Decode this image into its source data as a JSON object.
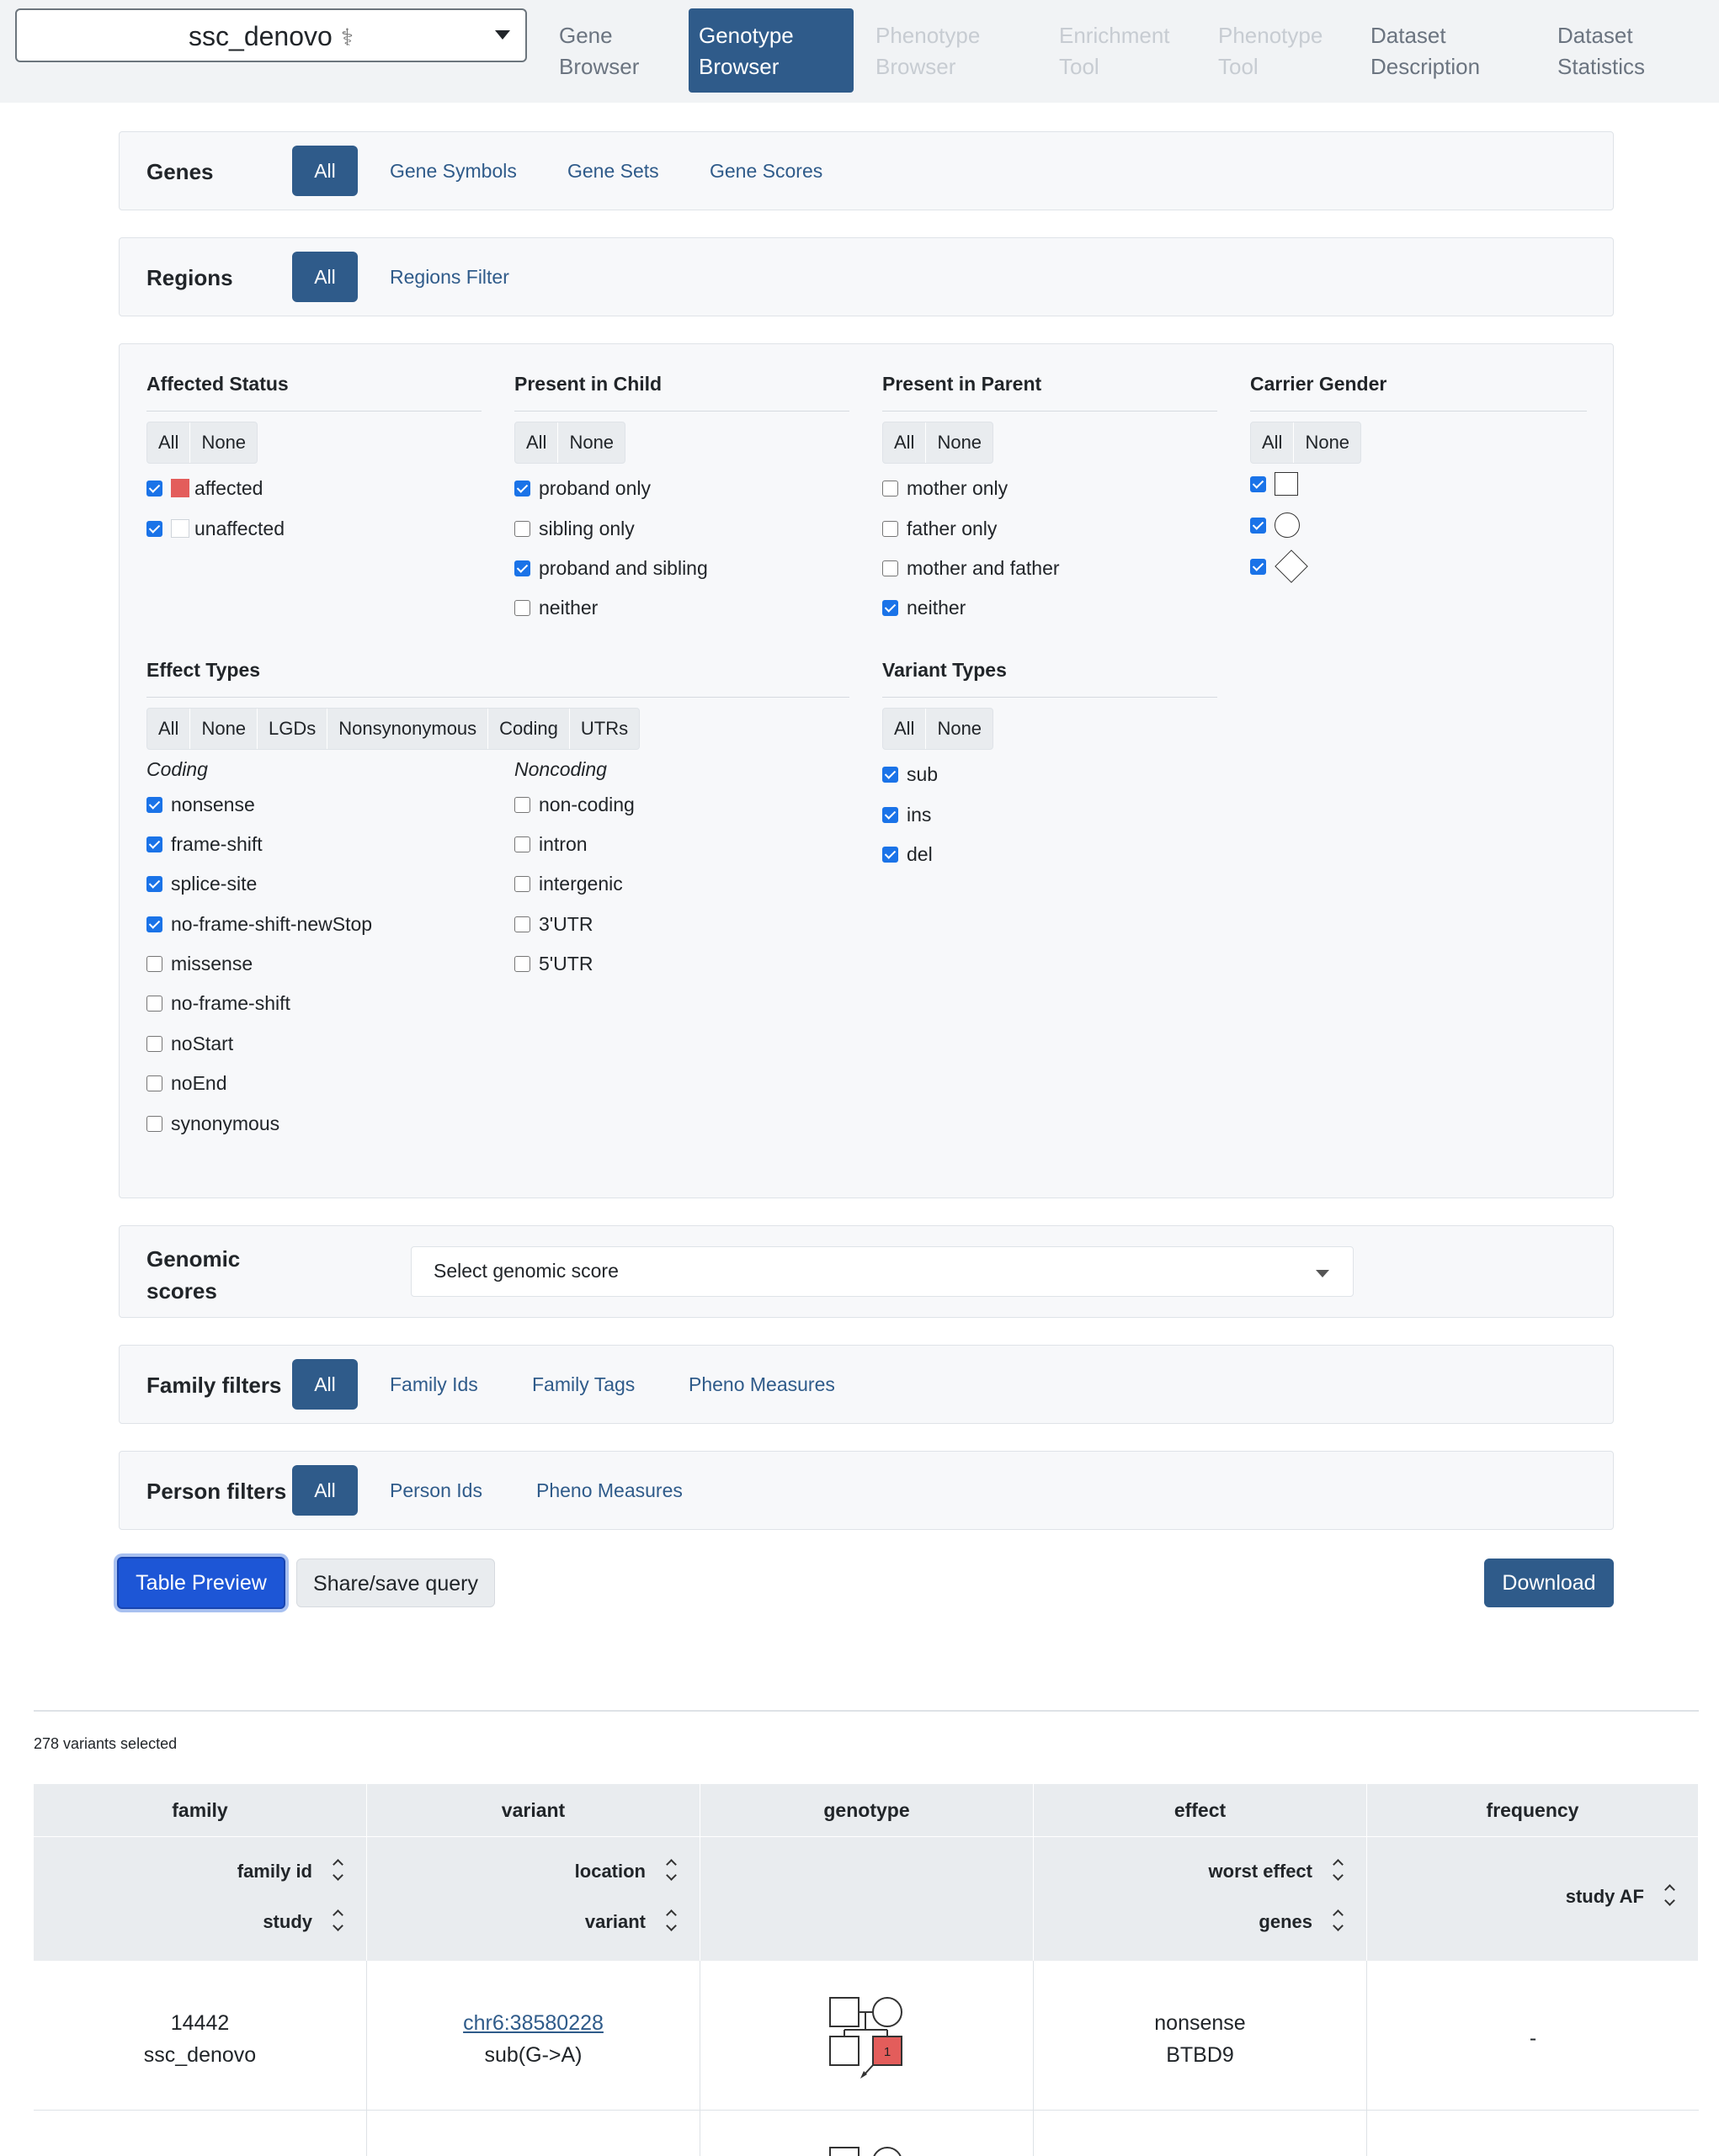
{
  "nav": {
    "dataset": "ssc_denovo",
    "dataset_icon": "dna-icon",
    "tabs": [
      {
        "label": "Gene\nBrowser",
        "state": "normal"
      },
      {
        "label": "Genotype\nBrowser",
        "state": "active"
      },
      {
        "label": "Phenotype\nBrowser",
        "state": "disabled"
      },
      {
        "label": "Enrichment\nTool",
        "state": "disabled"
      },
      {
        "label": "Phenotype\nTool",
        "state": "disabled"
      },
      {
        "label": "Dataset\nDescription",
        "state": "normal"
      },
      {
        "label": "Dataset\nStatistics",
        "state": "normal"
      }
    ]
  },
  "genes": {
    "title": "Genes",
    "tabs": [
      "All",
      "Gene Symbols",
      "Gene Sets",
      "Gene Scores"
    ],
    "active": "All"
  },
  "regions": {
    "title": "Regions",
    "tabs": [
      "All",
      "Regions Filter"
    ],
    "active": "All"
  },
  "filters": {
    "affected_status": {
      "title": "Affected Status",
      "buttons": [
        "All",
        "None"
      ],
      "options": [
        {
          "label": "affected",
          "checked": true,
          "color": "#e35d5b"
        },
        {
          "label": "unaffected",
          "checked": true,
          "color": "#ffffff"
        }
      ]
    },
    "present_in_child": {
      "title": "Present in Child",
      "buttons": [
        "All",
        "None"
      ],
      "options": [
        {
          "label": "proband only",
          "checked": true
        },
        {
          "label": "sibling only",
          "checked": false
        },
        {
          "label": "proband and sibling",
          "checked": true
        },
        {
          "label": "neither",
          "checked": false
        }
      ]
    },
    "present_in_parent": {
      "title": "Present in Parent",
      "buttons": [
        "All",
        "None"
      ],
      "options": [
        {
          "label": "mother only",
          "checked": false
        },
        {
          "label": "father only",
          "checked": false
        },
        {
          "label": "mother and father",
          "checked": false
        },
        {
          "label": "neither",
          "checked": true
        }
      ]
    },
    "carrier_gender": {
      "title": "Carrier Gender",
      "buttons": [
        "All",
        "None"
      ],
      "options": [
        {
          "glyph": "male-square-icon",
          "checked": true
        },
        {
          "glyph": "female-circle-icon",
          "checked": true
        },
        {
          "glyph": "unspecified-diamond-icon",
          "checked": true
        }
      ]
    },
    "effect_types": {
      "title": "Effect Types",
      "buttons": [
        "All",
        "None",
        "LGDs",
        "Nonsynonymous",
        "Coding",
        "UTRs"
      ],
      "coding_title": "Coding",
      "coding": [
        {
          "label": "nonsense",
          "checked": true
        },
        {
          "label": "frame-shift",
          "checked": true
        },
        {
          "label": "splice-site",
          "checked": true
        },
        {
          "label": "no-frame-shift-newStop",
          "checked": true
        },
        {
          "label": "missense",
          "checked": false
        },
        {
          "label": "no-frame-shift",
          "checked": false
        },
        {
          "label": "noStart",
          "checked": false
        },
        {
          "label": "noEnd",
          "checked": false
        },
        {
          "label": "synonymous",
          "checked": false
        }
      ],
      "noncoding_title": "Noncoding",
      "noncoding": [
        {
          "label": "non-coding",
          "checked": false
        },
        {
          "label": "intron",
          "checked": false
        },
        {
          "label": "intergenic",
          "checked": false
        },
        {
          "label": "3'UTR",
          "checked": false
        },
        {
          "label": "5'UTR",
          "checked": false
        }
      ]
    },
    "variant_types": {
      "title": "Variant Types",
      "buttons": [
        "All",
        "None"
      ],
      "options": [
        {
          "label": "sub",
          "checked": true
        },
        {
          "label": "ins",
          "checked": true
        },
        {
          "label": "del",
          "checked": true
        }
      ]
    }
  },
  "genomic_scores": {
    "title": "Genomic\nscores",
    "placeholder": "Select genomic score"
  },
  "family_filters": {
    "title": "Family filters",
    "tabs": [
      "All",
      "Family Ids",
      "Family Tags",
      "Pheno Measures"
    ],
    "active": "All"
  },
  "person_filters": {
    "title": "Person filters",
    "tabs": [
      "All",
      "Person Ids",
      "Pheno Measures"
    ],
    "active": "All"
  },
  "actions": {
    "preview": "Table Preview",
    "share": "Share/save query",
    "download": "Download"
  },
  "results": {
    "summary": "278 variants selected",
    "groups": [
      "family",
      "variant",
      "genotype",
      "effect",
      "frequency"
    ],
    "sort_columns": {
      "family": [
        "family id",
        "study"
      ],
      "variant": [
        "location",
        "variant"
      ],
      "effect": [
        "worst effect",
        "genes"
      ],
      "frequency": [
        "study AF"
      ]
    },
    "rows": [
      {
        "family_id": "14442",
        "study": "ssc_denovo",
        "location": "chr6:38580228",
        "variant": "sub(G->A)",
        "worst_effect": "nonsense",
        "genes": "BTBD9",
        "study_af": "-",
        "proband_label": "1"
      }
    ]
  }
}
